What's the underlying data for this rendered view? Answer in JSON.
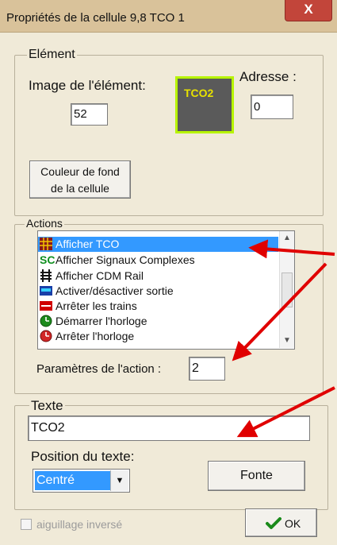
{
  "window": {
    "title": "Propriétés de la cellule 9,8 TCO 1",
    "close_label": "X"
  },
  "element_group": {
    "legend": "Elément",
    "image_label": "Image de l'élément:",
    "image_value": "52",
    "preview_text": "TCO2",
    "address_label": "Adresse :",
    "address_value": "0",
    "bg_button_line1": "Couleur de fond",
    "bg_button_line2": "de la cellule"
  },
  "actions_group": {
    "legend": "Actions",
    "items": [
      {
        "label": "Afficher TCO",
        "icon": "grid-icon",
        "selected": true
      },
      {
        "label": "Afficher Signaux Complexes",
        "icon": "sc-icon",
        "selected": false
      },
      {
        "label": "Afficher CDM Rail",
        "icon": "rail-icon",
        "selected": false
      },
      {
        "label": "Activer/désactiver sortie",
        "icon": "output-icon",
        "selected": false
      },
      {
        "label": "Arrêter les trains",
        "icon": "stop-icon",
        "selected": false
      },
      {
        "label": "Démarrer l'horloge",
        "icon": "clock-green-icon",
        "selected": false
      },
      {
        "label": "Arrêter l'horloge",
        "icon": "clock-red-icon",
        "selected": false
      }
    ],
    "param_label": "Paramètres de l'action :",
    "param_value": "2"
  },
  "text_group": {
    "legend": "Texte",
    "text_value": "TCO2",
    "position_label": "Position du texte:",
    "position_value": "Centré",
    "font_button": "Fonte"
  },
  "footer": {
    "checkbox_label": "aiguillage inversé",
    "ok_label": "OK"
  },
  "colors": {
    "arrow": "#e00000",
    "selection": "#3399ff",
    "preview_border": "#b7f400"
  }
}
